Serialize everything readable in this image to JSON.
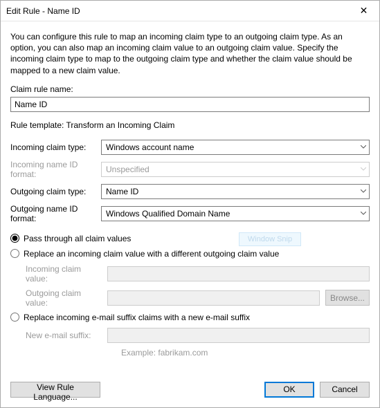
{
  "window": {
    "title": "Edit Rule - Name ID"
  },
  "description": "You can configure this rule to map an incoming claim type to an outgoing claim type. As an option, you can also map an incoming claim value to an outgoing claim value. Specify the incoming claim type to map to the outgoing claim type and whether the claim value should be mapped to a new claim value.",
  "labels": {
    "claim_rule_name": "Claim rule name:",
    "rule_template": "Rule template: Transform an Incoming Claim",
    "incoming_claim_type": "Incoming claim type:",
    "incoming_name_id_format": "Incoming name ID format:",
    "outgoing_claim_type": "Outgoing claim type:",
    "outgoing_name_id_format": "Outgoing name ID format:",
    "incoming_claim_value": "Incoming claim value:",
    "outgoing_claim_value": "Outgoing claim value:",
    "new_email_suffix": "New e-mail suffix:",
    "example": "Example: fabrikam.com"
  },
  "values": {
    "claim_rule_name": "Name ID",
    "incoming_claim_type": "Windows account name",
    "incoming_name_id_format": "Unspecified",
    "outgoing_claim_type": "Name ID",
    "outgoing_name_id_format": "Windows Qualified Domain Name",
    "incoming_claim_value": "",
    "outgoing_claim_value": "",
    "new_email_suffix": ""
  },
  "radio": {
    "pass_through": "Pass through all claim values",
    "replace_value": "Replace an incoming claim value with a different outgoing claim value",
    "replace_suffix": "Replace incoming e-mail suffix claims with a new e-mail suffix"
  },
  "buttons": {
    "browse": "Browse...",
    "view_rule_language": "View Rule Language...",
    "ok": "OK",
    "cancel": "Cancel"
  },
  "ghost": "Window Snip"
}
